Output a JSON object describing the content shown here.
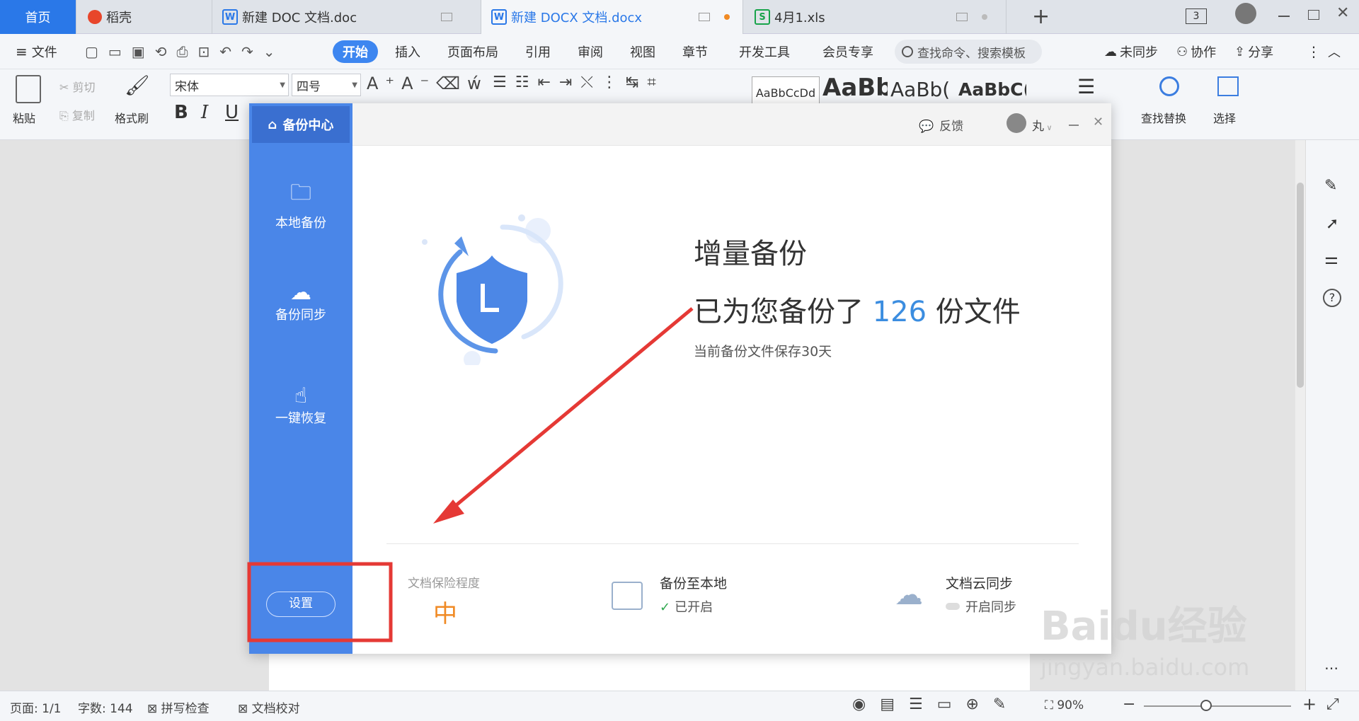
{
  "tabs": {
    "home": "首页",
    "daoke": "稻壳",
    "doc1": "新建 DOC 文档.doc",
    "doc2": "新建 DOCX 文档.docx",
    "xls": "4月1.xls",
    "add": "+",
    "count": "3"
  },
  "menu": {
    "file": "文件",
    "items": [
      "开始",
      "插入",
      "页面布局",
      "引用",
      "审阅",
      "视图",
      "章节",
      "开发工具",
      "会员专享"
    ],
    "search": "查找命令、搜索模板",
    "unsynced": "未同步",
    "collab": "协作",
    "share": "分享"
  },
  "ribbon": {
    "paste": "粘贴",
    "cut": "剪切",
    "copy": "复制",
    "format_painter": "格式刷",
    "font": "宋体",
    "size": "四号",
    "bold": "B",
    "italic": "I",
    "underline": "U",
    "style_samples": [
      "AaBbCcDd",
      "AaBb",
      "AaBb(",
      "AaBbC("
    ],
    "find_replace": "查找替换",
    "select": "选择"
  },
  "dialog": {
    "title": "备份中心",
    "feedback": "反馈",
    "user": "丸",
    "sidebar": [
      "本地备份",
      "备份同步",
      "一键恢复"
    ],
    "settings": "设置",
    "heading": "增量备份",
    "backed_prefix": "已为您备份了",
    "backed_count": "126",
    "backed_suffix": "份文件",
    "retention": "当前备份文件保存30天",
    "protect_label": "文档保险程度",
    "protect_value": "中",
    "local_title": "备份至本地",
    "local_status": "已开启",
    "cloud_title": "文档云同步",
    "cloud_status": "开启同步"
  },
  "status": {
    "page": "页面: 1/1",
    "words": "字数: 144",
    "spell": "拼写检查",
    "proof": "文档校对",
    "zoom": "90%"
  },
  "watermark": {
    "logo": "Baidu经验",
    "url": "jingyan.baidu.com"
  },
  "colors": {
    "accent": "#4a86e8",
    "count": "#3b8de0",
    "annotation": "#e53935",
    "orange": "#f08a24"
  }
}
